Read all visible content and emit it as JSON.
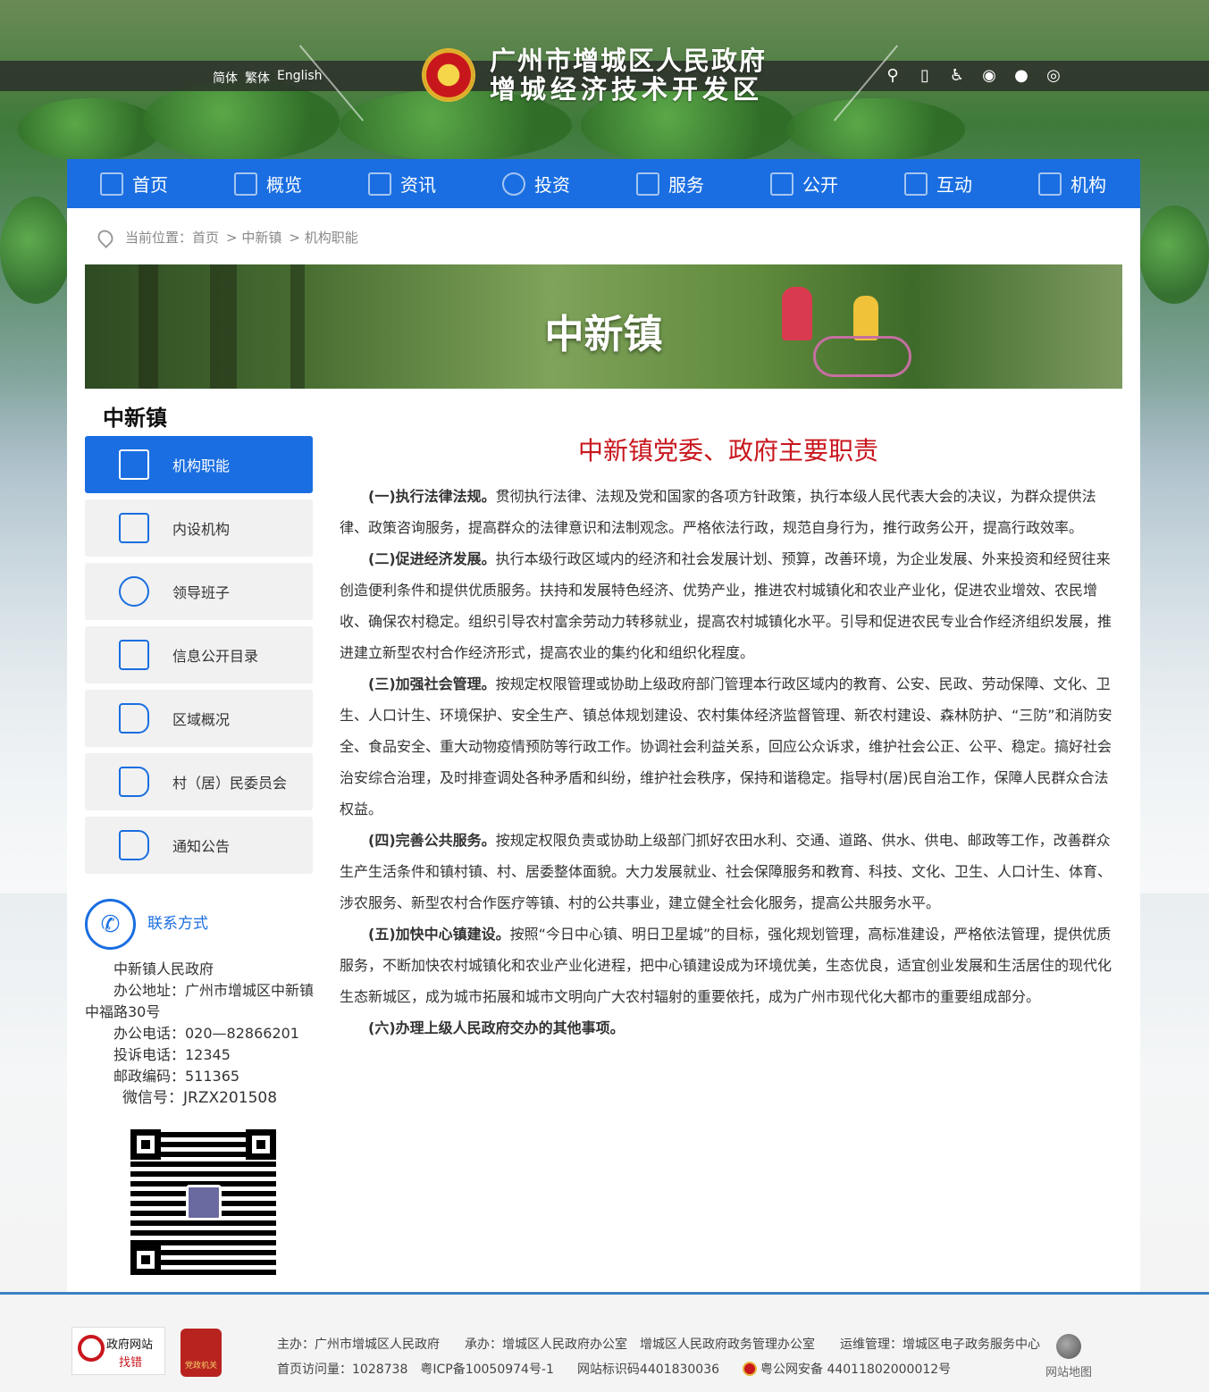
{
  "header": {
    "langs": [
      "简体",
      "繁体",
      "English"
    ],
    "title_line1": "广州市增城区人民政府",
    "title_line2": "增城经济技术开发区",
    "tools": [
      "search-icon",
      "mobile-icon",
      "accessibility-icon",
      "weibo-icon",
      "wechat-icon",
      "rss-icon"
    ]
  },
  "nav": {
    "items": [
      {
        "label": "首页",
        "icon": "home-icon"
      },
      {
        "label": "概览",
        "icon": "list-icon"
      },
      {
        "label": "资讯",
        "icon": "news-icon"
      },
      {
        "label": "投资",
        "icon": "globe-icon"
      },
      {
        "label": "服务",
        "icon": "briefcase-icon"
      },
      {
        "label": "公开",
        "icon": "monitor-icon"
      },
      {
        "label": "互动",
        "icon": "chat-icon"
      },
      {
        "label": "机构",
        "icon": "org-icon"
      }
    ]
  },
  "breadcrumb": {
    "prefix": "当前位置：",
    "items": [
      "首页",
      "> 中新镇",
      "> 机构职能"
    ]
  },
  "banner": {
    "title": "中新镇"
  },
  "sidebar": {
    "title": "中新镇",
    "items": [
      {
        "label": "机构职能",
        "active": true
      },
      {
        "label": "内设机构"
      },
      {
        "label": "领导班子"
      },
      {
        "label": "信息公开目录"
      },
      {
        "label": "区域概况"
      },
      {
        "label": "村（居）民委员会"
      },
      {
        "label": "通知公告"
      }
    ]
  },
  "contact": {
    "title": "联系方式",
    "org": "中新镇人民政府",
    "address": "办公地址：广州市增城区中新镇中福路30号",
    "phone": "办公电话：020—82866201",
    "complaint": "投诉电话：12345",
    "postcode": "邮政编码：511365",
    "wechat": "微信号：JRZX201508"
  },
  "article": {
    "title": "中新镇党委、政府主要职责",
    "paragraphs": [
      {
        "head": "(一)执行法律法规。",
        "body": "贯彻执行法律、法规及党和国家的各项方针政策，执行本级人民代表大会的决议，为群众提供法律、政策咨询服务，提高群众的法律意识和法制观念。严格依法行政，规范自身行为，推行政务公开，提高行政效率。"
      },
      {
        "head": "(二)促进经济发展。",
        "body": "执行本级行政区域内的经济和社会发展计划、预算，改善环境，为企业发展、外来投资和经贸往来创造便利条件和提供优质服务。扶持和发展特色经济、优势产业，推进农村城镇化和农业产业化，促进农业增效、农民增收、确保农村稳定。组织引导农村富余劳动力转移就业，提高农村城镇化水平。引导和促进农民专业合作经济组织发展，推进建立新型农村合作经济形式，提高农业的集约化和组织化程度。"
      },
      {
        "head": "(三)加强社会管理。",
        "body": "按规定权限管理或协助上级政府部门管理本行政区域内的教育、公安、民政、劳动保障、文化、卫生、人口计生、环境保护、安全生产、镇总体规划建设、农村集体经济监督管理、新农村建设、森林防护、“三防”和消防安全、食品安全、重大动物疫情预防等行政工作。协调社会利益关系，回应公众诉求，维护社会公正、公平、稳定。搞好社会治安综合治理，及时排查调处各种矛盾和纠纷，维护社会秩序，保持和谐稳定。指导村(居)民自治工作，保障人民群众合法权益。"
      },
      {
        "head": "(四)完善公共服务。",
        "body": "按规定权限负责或协助上级部门抓好农田水利、交通、道路、供水、供电、邮政等工作，改善群众生产生活条件和镇村镇、村、居委整体面貌。大力发展就业、社会保障服务和教育、科技、文化、卫生、人口计生、体育、涉农服务、新型农村合作医疗等镇、村的公共事业，建立健全社会化服务，提高公共服务水平。"
      },
      {
        "head": "(五)加快中心镇建设。",
        "body": "按照“今日中心镇、明日卫星城”的目标，强化规划管理，高标准建设，严格依法管理，提供优质服务，不断加快农村城镇化和农业产业化进程，把中心镇建设成为环境优美，生态优良，适宜创业发展和生活居住的现代化生态新城区，成为城市拓展和城市文明向广大农村辐射的重要依托，成为广州市现代化大都市的重要组成部分。"
      },
      {
        "head": "(六)办理上级人民政府交办的其他事项。",
        "body": ""
      }
    ]
  },
  "footer": {
    "badge1_line1": "政府网站",
    "badge1_line2": "找错",
    "badge2_text": "党政机关",
    "sponsor": "主办：广州市增城区人民政府",
    "undertaker": "承办：增城区人民政府办公室",
    "undertaker2": "增城区人民政府政务管理办公室",
    "ops": "运维管理：增城区电子政务服务中心",
    "visits": "首页访问量：1028738",
    "icp": "粤ICP备10050974号-1",
    "siteid": "网站标识码4401830036",
    "police": "粤公网安备 44011802000012号",
    "sitemap": "网站地图"
  }
}
